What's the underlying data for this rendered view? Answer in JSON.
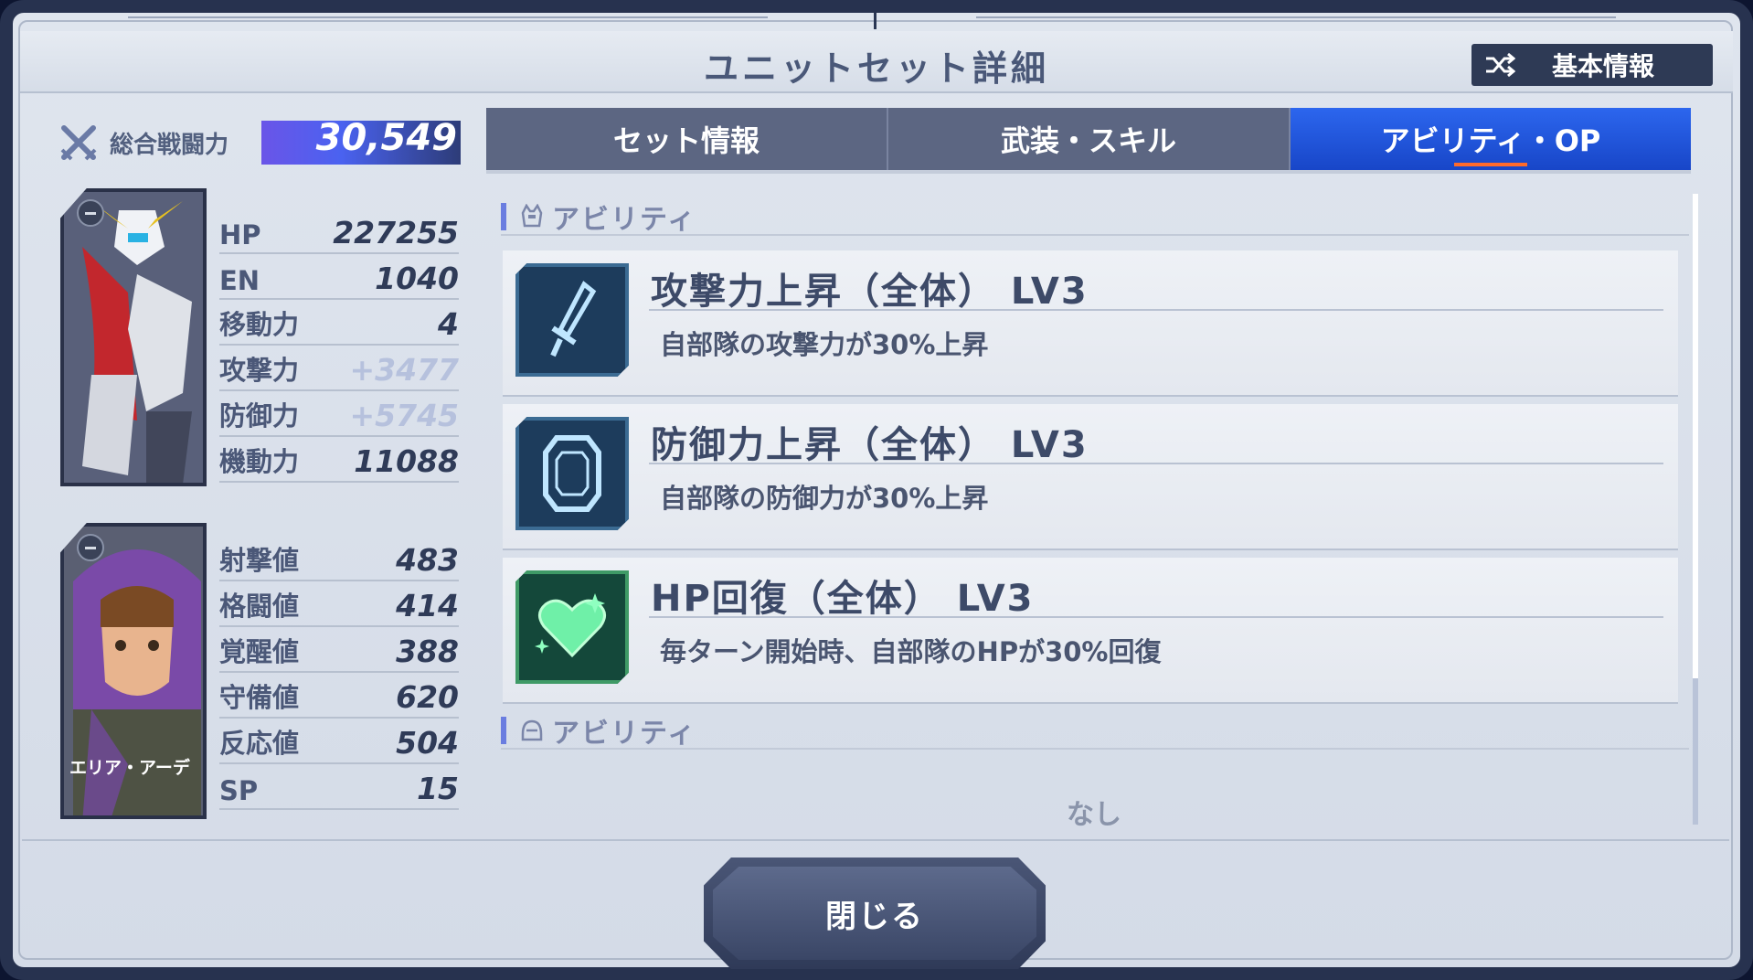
{
  "header": {
    "title": "ユニットセット詳細",
    "basic_info_label": "基本情報"
  },
  "power": {
    "label": "総合戦闘力",
    "value": "30,549"
  },
  "unit_stats": [
    {
      "label": "HP",
      "value": "227255"
    },
    {
      "label": "EN",
      "value": "1040"
    },
    {
      "label": "移動力",
      "value": "4"
    },
    {
      "label": "攻撃力",
      "value": "+3477"
    },
    {
      "label": "防御力",
      "value": "+5745"
    },
    {
      "label": "機動力",
      "value": "11088"
    }
  ],
  "pilot": {
    "name": "エリア・アーデ"
  },
  "pilot_stats": [
    {
      "label": "射撃値",
      "value": "483"
    },
    {
      "label": "格闘値",
      "value": "414"
    },
    {
      "label": "覚醒値",
      "value": "388"
    },
    {
      "label": "守備値",
      "value": "620"
    },
    {
      "label": "反応値",
      "value": "504"
    },
    {
      "label": "SP",
      "value": "15"
    }
  ],
  "tabs": [
    {
      "label": "セット情報",
      "active": false
    },
    {
      "label": "武装・スキル",
      "active": false
    },
    {
      "label": "アビリティ・OP",
      "active": true
    }
  ],
  "sections": {
    "unit_ability_label": "アビリティ",
    "pilot_ability_label": "アビリティ",
    "pilot_ability_none": "なし"
  },
  "abilities": [
    {
      "name": "攻撃力上昇（全体） LV3",
      "desc": "自部隊の攻撃力が30%上昇",
      "icon": "sword-icon",
      "color": "#2a6fae"
    },
    {
      "name": "防御力上昇（全体） LV3",
      "desc": "自部隊の防御力が30%上昇",
      "icon": "shield-icon",
      "color": "#2a6fae"
    },
    {
      "name": "HP回復（全体） LV3",
      "desc": "毎ターン開始時、自部隊のHPが30%回復",
      "icon": "heart-icon",
      "color": "#3f9a66"
    }
  ],
  "close_label": "閉じる"
}
